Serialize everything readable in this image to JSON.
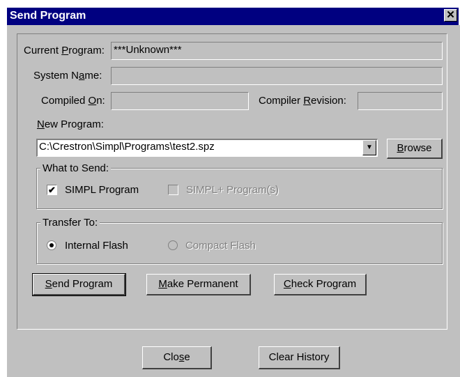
{
  "window": {
    "title": "Send Program",
    "close_glyph": "✕"
  },
  "fields": {
    "current_program": {
      "label_pre": "Current ",
      "label_u": "P",
      "label_post": "rogram:",
      "value": "***Unknown***"
    },
    "system_name": {
      "label_pre": "System N",
      "label_u": "a",
      "label_post": "me:",
      "value": ""
    },
    "compiled_on": {
      "label_pre": "Compiled ",
      "label_u": "O",
      "label_post": "n:",
      "value": ""
    },
    "compiler_revision": {
      "label_pre": "Compiler ",
      "label_u": "R",
      "label_post": "evision:",
      "value": ""
    }
  },
  "new_program": {
    "label_pre": "",
    "label_u": "N",
    "label_post": "ew Program:",
    "value": "C:\\Crestron\\Simpl\\Programs\\test2.spz",
    "browse_u": "B",
    "browse_post": "rowse"
  },
  "what_to_send": {
    "title": "What to Send:",
    "simpl_program": {
      "label": "SIMPL Program",
      "checked": true,
      "enabled": true
    },
    "simpl_plus": {
      "label": "SIMPL+ Program(s)",
      "checked": false,
      "enabled": false
    }
  },
  "transfer_to": {
    "title": "Transfer To:",
    "internal_flash": {
      "label": "Internal Flash",
      "selected": true,
      "enabled": true
    },
    "compact_flash": {
      "label": "Compact Flash",
      "selected": false,
      "enabled": false
    }
  },
  "actions": {
    "send_program": {
      "u": "S",
      "post": "end Program"
    },
    "make_permanent": {
      "u": "M",
      "post": "ake Permanent"
    },
    "check_program": {
      "u": "C",
      "post": "heck Program"
    }
  },
  "footer": {
    "close": {
      "pre": "Clo",
      "u": "s",
      "post": "e"
    },
    "clear_history": "Clear History"
  },
  "icons": {
    "checkmark": "✔",
    "dropdown_arrow": "▼"
  }
}
